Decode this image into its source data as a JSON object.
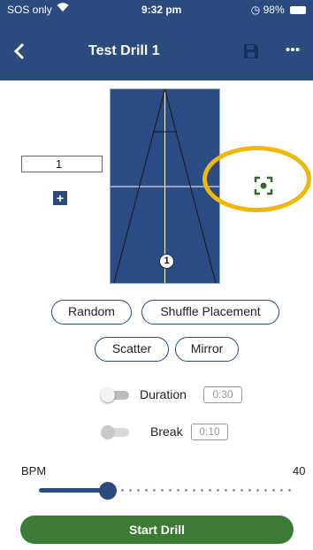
{
  "status_bar": {
    "carrier": "SOS only",
    "time": "9:32 pm",
    "battery": "98%"
  },
  "app_bar": {
    "title": "Test Drill 1",
    "back_icon": "chevron-left-icon",
    "save_icon": "floppy-disk-icon",
    "more_icon": "ellipsis-icon"
  },
  "court": {
    "player_number": "1",
    "player_count": "1",
    "add_icon": "plus-icon",
    "focus_icon": "center-focus-icon"
  },
  "placement_buttons": {
    "random": "Random",
    "shuffle": "Shuffle Placement",
    "scatter": "Scatter",
    "mirror": "Mirror"
  },
  "toggles": {
    "duration": {
      "label": "Duration",
      "value": "0:30",
      "on": false
    },
    "break": {
      "label": "Break",
      "value": "0:10",
      "on": false
    }
  },
  "bpm": {
    "label": "BPM",
    "value": "40",
    "level": 0.27
  },
  "start_button": {
    "label": "Start Drill"
  },
  "colors": {
    "primary": "#2b4a7e",
    "court": "#2c4c84",
    "start": "#3d7a35",
    "highlight": "#f2b705"
  }
}
